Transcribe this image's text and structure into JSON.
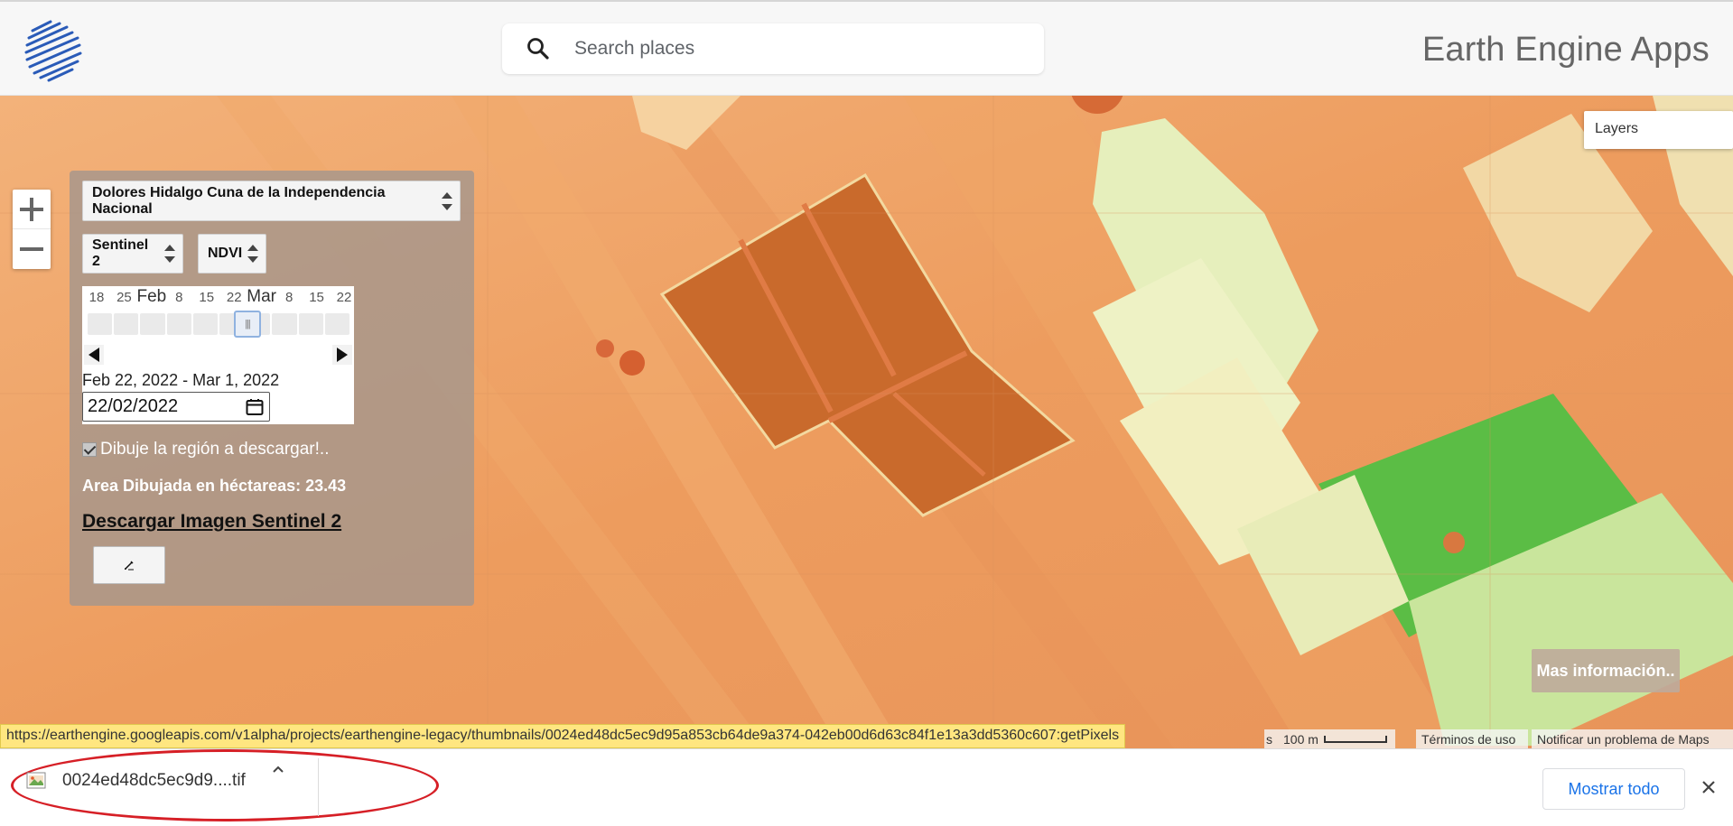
{
  "header": {
    "search_placeholder": "Search places",
    "app_title": "Earth Engine Apps"
  },
  "map": {
    "layers_label": "Layers",
    "mas_info_label": "Mas información..",
    "scale_label": "100 m",
    "terms_label": "Términos de uso",
    "report_label": "Notificar un problema de Maps",
    "attrib_fragment": "s"
  },
  "panel": {
    "region_select": "Dolores Hidalgo Cuna de la Independencia Nacional",
    "satellite_select": "Sentinel 2",
    "index_select": "NDVI",
    "timeline_labels": [
      {
        "text": "18",
        "month": false
      },
      {
        "text": "25",
        "month": false
      },
      {
        "text": "Feb",
        "month": true
      },
      {
        "text": "8",
        "month": false
      },
      {
        "text": "15",
        "month": false
      },
      {
        "text": "22",
        "month": false
      },
      {
        "text": "Mar",
        "month": true
      },
      {
        "text": "8",
        "month": false
      },
      {
        "text": "15",
        "month": false
      },
      {
        "text": "22",
        "month": false
      }
    ],
    "date_range": "Feb 22, 2022 - Mar 1, 2022",
    "date_input": "22/02/2022",
    "draw_checkbox_label": "Dibuje la región a descargar!..",
    "area_label": "Area Dibujada en héctareas: 23.43",
    "download_link": "Descargar Imagen Sentinel 2",
    "draw_button_icon": "pencil-icon"
  },
  "status_bar": {
    "url": "https://earthengine.googleapis.com/v1alpha/projects/earthengine-legacy/thumbnails/0024ed48dc5ec9d95a853cb64de9a374-042eb00d6d63c84f1e13a3dd5360c607:getPixels"
  },
  "download_shelf": {
    "file_name": "0024ed48dc5ec9d9....tif",
    "show_all_label": "Mostrar todo",
    "highlight_color": "#d61f26"
  },
  "colors": {
    "map_base": "#ec9a5c",
    "field_dark": "#c96a2c",
    "vegetation_light": "#e6efbc",
    "vegetation_green": "#5bbd45",
    "link_blue": "#1a73e8"
  }
}
